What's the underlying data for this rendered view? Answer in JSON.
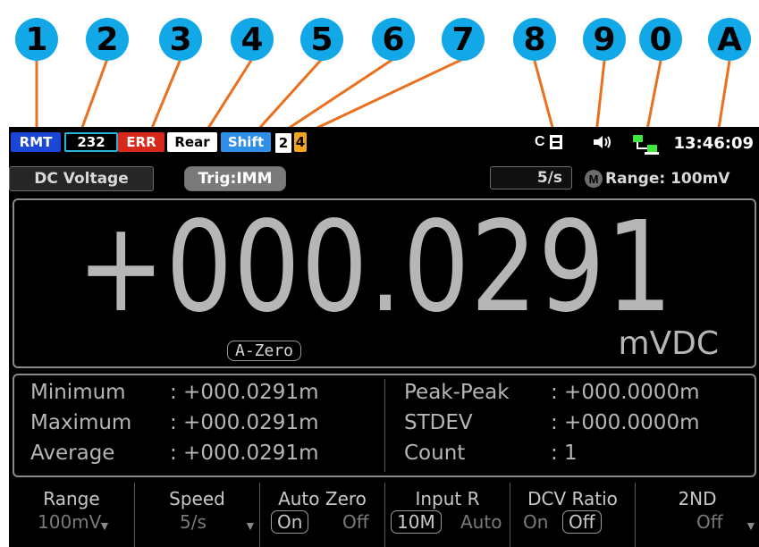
{
  "callouts": [
    "1",
    "2",
    "3",
    "4",
    "5",
    "6",
    "7",
    "8",
    "9",
    "0",
    "A"
  ],
  "status": {
    "rmt": "RMT",
    "rs232": "232",
    "err": "ERR",
    "rear": "Rear",
    "shift": "Shift",
    "n2": "2",
    "n4": "4",
    "c_label": "C",
    "time": "13:46:09"
  },
  "info": {
    "function": "DC Voltage",
    "trigger": "Trig:IMM",
    "rate": "5/s",
    "m_label": "M",
    "range": "Range: 100mV"
  },
  "reading": {
    "value": "+000.0291",
    "unit": "mVDC",
    "azero": "A-Zero"
  },
  "stats": {
    "min_label": "Minimum",
    "min_value": ": +000.0291m",
    "max_label": "Maximum",
    "max_value": ": +000.0291m",
    "avg_label": "Average",
    "avg_value": ": +000.0291m",
    "pp_label": "Peak-Peak",
    "pp_value": ": +000.0000m",
    "std_label": "STDEV",
    "std_value": ": +000.0000m",
    "count_label": "Count",
    "count_value": ":  1"
  },
  "softkeys": [
    {
      "title": "Range",
      "v1": "100mV"
    },
    {
      "title": "Speed",
      "v1": "5/s"
    },
    {
      "title": "Auto Zero",
      "v1": "On",
      "v2": "Off"
    },
    {
      "title": "Input R",
      "v1": "10M",
      "v2": "Auto"
    },
    {
      "title": "DCV Ratio",
      "v1": "On",
      "v2": "Off"
    },
    {
      "title": "2ND",
      "v1": "Off"
    }
  ],
  "colors": {
    "callout": "#12a8e8",
    "leader": "#e8701e",
    "rmt": "#1c47d6",
    "err": "#d8281c",
    "shift": "#2f8ee8",
    "n4": "#f4a41c"
  },
  "icons": [
    "keyboard-lock-icon",
    "speaker-icon",
    "network-icon",
    "chevron-down-icon"
  ]
}
